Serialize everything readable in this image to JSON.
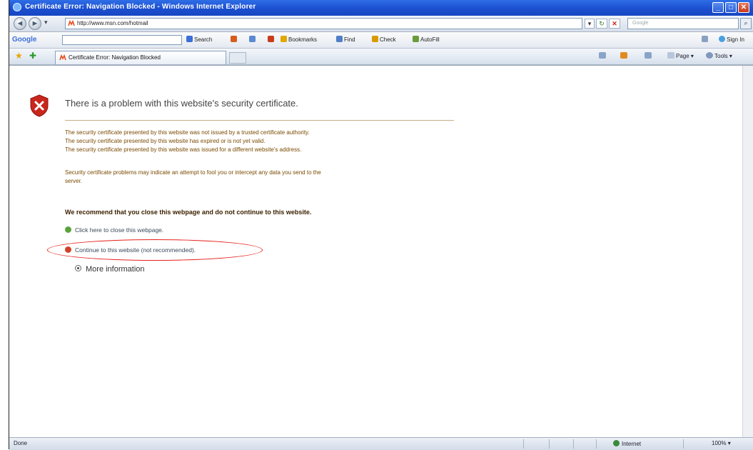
{
  "window": {
    "title": "Certificate Error: Navigation Blocked - Windows Internet Explorer",
    "controls": [
      "_",
      "□",
      "✕"
    ]
  },
  "address_bar": {
    "back_label": "◄",
    "forward_label": "►",
    "dropdown_label": "▾",
    "url": "http://www.msn.com/hotmail",
    "search_placeholder": "Google",
    "refresh_label": "↻",
    "stop_label": "✕",
    "go_label": "⌕"
  },
  "google_toolbar": {
    "logo": "Google",
    "items": [
      {
        "label": "Search",
        "icon": "search-icon",
        "color": "#3b6fd8"
      },
      {
        "label": "Bookmarks",
        "icon": "star-icon",
        "color": "#e0a800"
      },
      {
        "label": "Find",
        "icon": "find-icon",
        "color": "#4f7fc7"
      },
      {
        "label": "Check",
        "icon": "check-icon",
        "color": "#d99a00"
      },
      {
        "label": "AutoFill",
        "icon": "autofill-icon",
        "color": "#6b9b3a"
      }
    ],
    "signin": "Sign In"
  },
  "tabs": {
    "favorites_star": "★",
    "add_favorites": "✚",
    "active_tab": "Certificate Error: Navigation Blocked"
  },
  "command_bar": {
    "items": [
      {
        "label": "Home",
        "icon": "home-icon"
      },
      {
        "label": "Feeds",
        "icon": "feeds-icon"
      },
      {
        "label": "Print",
        "icon": "print-icon"
      },
      {
        "label": "Page",
        "icon": "page-icon"
      },
      {
        "label": "Tools",
        "icon": "tools-icon"
      }
    ]
  },
  "page": {
    "heading": "There is a problem with this website's security certificate.",
    "reasons": [
      "The security certificate presented by this website was not issued by a trusted certificate authority.",
      "The security certificate presented by this website has expired or is not yet valid.",
      "The security certificate presented by this website was issued for a different website's address."
    ],
    "warning_line1": "Security certificate problems may indicate an attempt to fool you or intercept any data you send to the",
    "warning_line2": "server.",
    "recommendation": "We recommend that you close this webpage and do not continue to this website.",
    "close_link": "Click here to close this webpage.",
    "continue_link": "Continue to this website (not recommended).",
    "more_info": "More information"
  },
  "status_bar": {
    "left": "Done",
    "zone": "Internet",
    "zoom": "100%"
  },
  "colors": {
    "titlebar": "#1c4fd0",
    "shield_red": "#c9261c",
    "body_text": "#7a4a00",
    "ellipse": "#e4201c",
    "close_dot": "#5aa33b",
    "continue_dot": "#d3402a"
  }
}
